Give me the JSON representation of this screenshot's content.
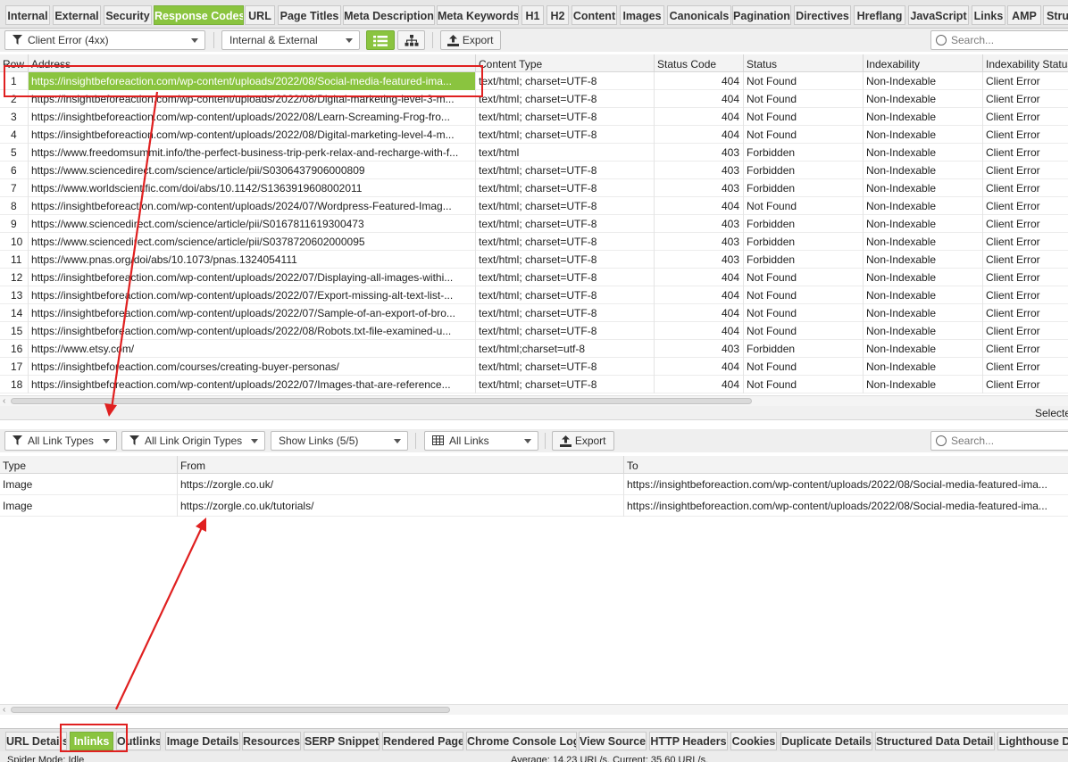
{
  "top_tabs": [
    "Internal",
    "External",
    "Security",
    "Response Codes",
    "URL",
    "Page Titles",
    "Meta Description",
    "Meta Keywords",
    "H1",
    "H2",
    "Content",
    "Images",
    "Canonicals",
    "Pagination",
    "Directives",
    "Hreflang",
    "JavaScript",
    "Links",
    "AMP",
    "Struc"
  ],
  "active_top_tab": "Response Codes",
  "toolbar": {
    "filter": "Client Error (4xx)",
    "scope": "Internal & External",
    "export_label": "Export",
    "search_placeholder": "Search..."
  },
  "main_table": {
    "columns": [
      "Row",
      "Address",
      "Content Type",
      "Status Code",
      "Status",
      "Indexability",
      "Indexability Status"
    ],
    "rows": [
      [
        "1",
        "https://insightbeforeaction.com/wp-content/uploads/2022/08/Social-media-featured-ima...",
        "text/html; charset=UTF-8",
        "404",
        "Not Found",
        "Non-Indexable",
        "Client Error"
      ],
      [
        "2",
        "https://insightbeforeaction.com/wp-content/uploads/2022/08/Digital-marketing-level-3-m...",
        "text/html; charset=UTF-8",
        "404",
        "Not Found",
        "Non-Indexable",
        "Client Error"
      ],
      [
        "3",
        "https://insightbeforeaction.com/wp-content/uploads/2022/08/Learn-Screaming-Frog-fro...",
        "text/html; charset=UTF-8",
        "404",
        "Not Found",
        "Non-Indexable",
        "Client Error"
      ],
      [
        "4",
        "https://insightbeforeaction.com/wp-content/uploads/2022/08/Digital-marketing-level-4-m...",
        "text/html; charset=UTF-8",
        "404",
        "Not Found",
        "Non-Indexable",
        "Client Error"
      ],
      [
        "5",
        "https://www.freedomsummit.info/the-perfect-business-trip-perk-relax-and-recharge-with-f...",
        "text/html",
        "403",
        "Forbidden",
        "Non-Indexable",
        "Client Error"
      ],
      [
        "6",
        "https://www.sciencedirect.com/science/article/pii/S0306437906000809",
        "text/html; charset=UTF-8",
        "403",
        "Forbidden",
        "Non-Indexable",
        "Client Error"
      ],
      [
        "7",
        "https://www.worldscientific.com/doi/abs/10.1142/S1363919608002011",
        "text/html; charset=UTF-8",
        "403",
        "Forbidden",
        "Non-Indexable",
        "Client Error"
      ],
      [
        "8",
        "https://insightbeforeaction.com/wp-content/uploads/2024/07/Wordpress-Featured-Imag...",
        "text/html; charset=UTF-8",
        "404",
        "Not Found",
        "Non-Indexable",
        "Client Error"
      ],
      [
        "9",
        "https://www.sciencedirect.com/science/article/pii/S0167811619300473",
        "text/html; charset=UTF-8",
        "403",
        "Forbidden",
        "Non-Indexable",
        "Client Error"
      ],
      [
        "10",
        "https://www.sciencedirect.com/science/article/pii/S0378720602000095",
        "text/html; charset=UTF-8",
        "403",
        "Forbidden",
        "Non-Indexable",
        "Client Error"
      ],
      [
        "11",
        "https://www.pnas.org/doi/abs/10.1073/pnas.1324054111",
        "text/html; charset=UTF-8",
        "403",
        "Forbidden",
        "Non-Indexable",
        "Client Error"
      ],
      [
        "12",
        "https://insightbeforeaction.com/wp-content/uploads/2022/07/Displaying-all-images-withi...",
        "text/html; charset=UTF-8",
        "404",
        "Not Found",
        "Non-Indexable",
        "Client Error"
      ],
      [
        "13",
        "https://insightbeforeaction.com/wp-content/uploads/2022/07/Export-missing-alt-text-list-...",
        "text/html; charset=UTF-8",
        "404",
        "Not Found",
        "Non-Indexable",
        "Client Error"
      ],
      [
        "14",
        "https://insightbeforeaction.com/wp-content/uploads/2022/07/Sample-of-an-export-of-bro...",
        "text/html; charset=UTF-8",
        "404",
        "Not Found",
        "Non-Indexable",
        "Client Error"
      ],
      [
        "15",
        "https://insightbeforeaction.com/wp-content/uploads/2022/08/Robots.txt-file-examined-u...",
        "text/html; charset=UTF-8",
        "404",
        "Not Found",
        "Non-Indexable",
        "Client Error"
      ],
      [
        "16",
        "https://www.etsy.com/",
        "text/html;charset=utf-8",
        "403",
        "Forbidden",
        "Non-Indexable",
        "Client Error"
      ],
      [
        "17",
        "https://insightbeforeaction.com/courses/creating-buyer-personas/",
        "text/html; charset=UTF-8",
        "404",
        "Not Found",
        "Non-Indexable",
        "Client Error"
      ],
      [
        "18",
        "https://insightbeforeaction.com/wp-content/uploads/2022/07/Images-that-are-reference...",
        "text/html; charset=UTF-8",
        "404",
        "Not Found",
        "Non-Indexable",
        "Client Error"
      ]
    ]
  },
  "selected_label": "Selecte",
  "lower_toolbar": {
    "link_types": "All Link Types",
    "link_origin_types": "All Link Origin Types",
    "show_links": "Show Links (5/5)",
    "all_links": "All Links",
    "export_label": "Export",
    "search_placeholder": "Search..."
  },
  "inlinks_table": {
    "columns": [
      "Type",
      "From",
      "To"
    ],
    "rows": [
      [
        "Image",
        "https://zorgle.co.uk/",
        "https://insightbeforeaction.com/wp-content/uploads/2022/08/Social-media-featured-ima..."
      ],
      [
        "Image",
        "https://zorgle.co.uk/tutorials/",
        "https://insightbeforeaction.com/wp-content/uploads/2022/08/Social-media-featured-ima..."
      ]
    ]
  },
  "bottom_tabs": [
    "URL Details",
    "Inlinks",
    "Outlinks",
    "Image Details",
    "Resources",
    "SERP Snippet",
    "Rendered Page",
    "Chrome Console Log",
    "View Source",
    "HTTP Headers",
    "Cookies",
    "Duplicate Details",
    "Structured Data Details",
    "Lighthouse De"
  ],
  "active_bottom_tab": "Inlinks",
  "status_bar": {
    "mode": "Spider Mode: Idle",
    "rate": "Average: 14.23 URL/s. Current: 35.60 URL/s."
  },
  "colors": {
    "accent_green": "#8ac43f",
    "annotation_red": "#e02020"
  }
}
